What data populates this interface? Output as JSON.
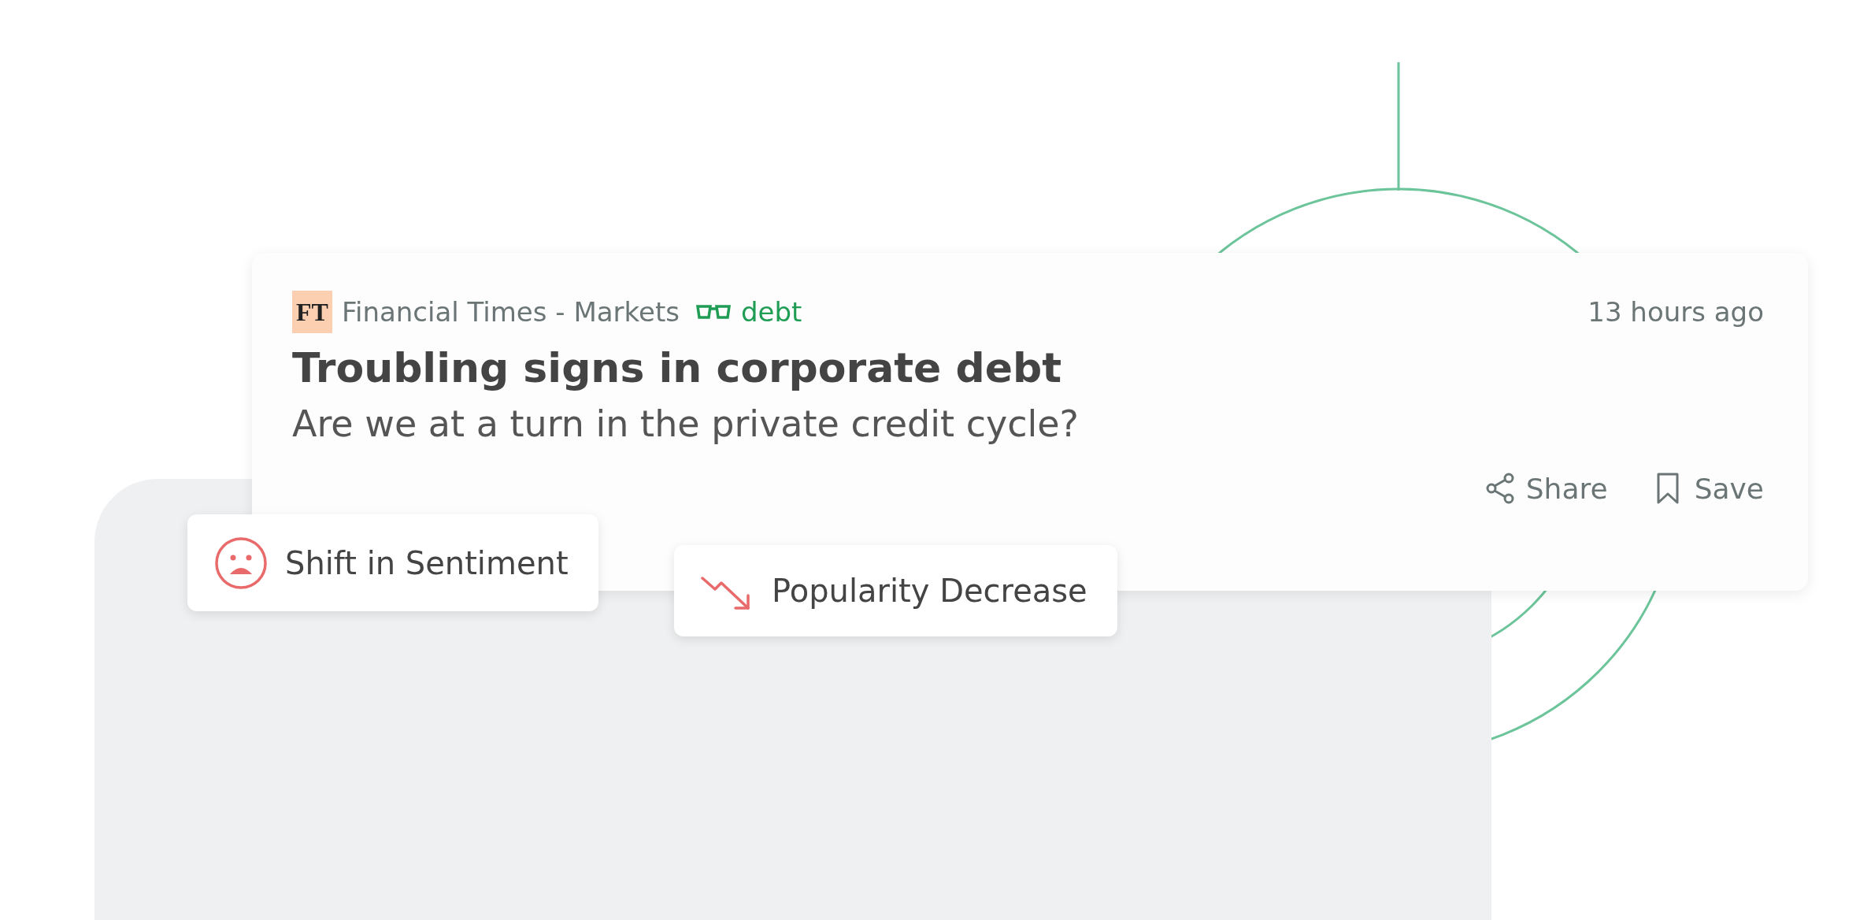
{
  "card": {
    "source": {
      "logo_text": "FT",
      "name": "Financial Times - Markets",
      "tag": "debt"
    },
    "time": "13 hours ago",
    "title": "Troubling signs in corporate debt",
    "summary": "Are we at a turn in the private credit cycle?",
    "actions": [
      {
        "label": "Share",
        "kind": "share"
      },
      {
        "label": "Save",
        "kind": "save"
      }
    ]
  },
  "signals": [
    {
      "label": "Shift in Sentiment",
      "kind": "sentiment"
    },
    {
      "label": "Popularity Decrease",
      "kind": "decrease"
    }
  ]
}
